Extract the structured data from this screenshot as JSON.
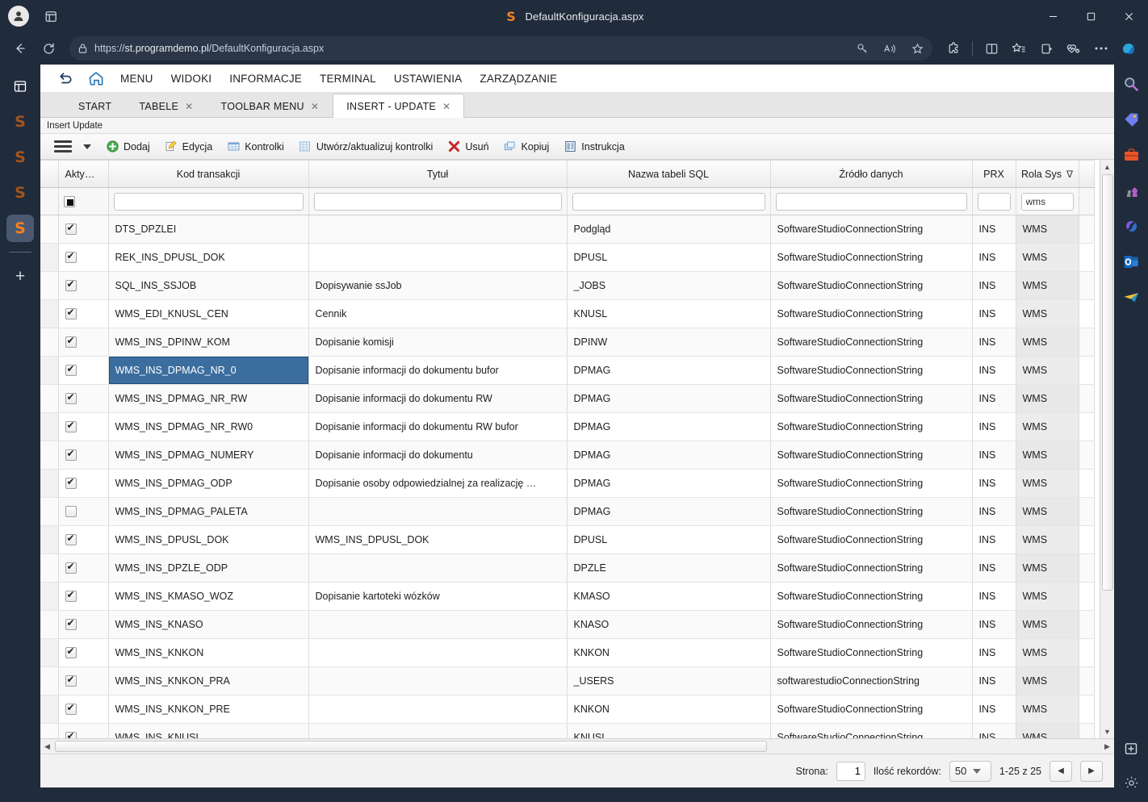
{
  "window": {
    "title": "DefaultKonfiguracja.aspx",
    "favicon": "S",
    "minimize_label": "–",
    "maximize_label": "❑",
    "close_label": "✕"
  },
  "browser": {
    "url_scheme": "https://",
    "url_host": "st.programdemo.pl",
    "url_path": "/DefaultKonfiguracja.aspx",
    "back_icon": "back-arrow-icon",
    "refresh_icon": "refresh-icon",
    "lock_icon": "lock-icon",
    "omnibox_icons": [
      "key-icon",
      "read-aloud-icon",
      "favorite-star-icon"
    ],
    "toolbar_icons": [
      "extensions-icon",
      "split-screen-icon",
      "favorites-icon",
      "collections-icon",
      "browser-essentials-icon",
      "settings-more-icon",
      "copilot-icon"
    ]
  },
  "left_sidebar": {
    "tabs_panel_icon": "vertical-tabs-icon",
    "items": [
      {
        "name": "tab-softwarestudio-1",
        "glyph": "S",
        "active": false
      },
      {
        "name": "tab-softwarestudio-2",
        "glyph": "S",
        "active": false
      },
      {
        "name": "tab-softwarestudio-3",
        "glyph": "S",
        "active": false
      },
      {
        "name": "tab-softwarestudio-4",
        "glyph": "S",
        "active": true
      }
    ],
    "add_tab_label": "+"
  },
  "right_sidebar": {
    "items": [
      {
        "name": "search-icon"
      },
      {
        "name": "tag-icon"
      },
      {
        "name": "briefcase-icon"
      },
      {
        "name": "games-icon"
      },
      {
        "name": "microsoft365-icon"
      },
      {
        "name": "outlook-icon"
      },
      {
        "name": "telegram-icon"
      }
    ],
    "add_label": "+",
    "settings_icon": "gear-icon"
  },
  "app": {
    "menu": {
      "back_icon": "undo-arrow-icon",
      "home_icon": "home-icon",
      "items": [
        "MENU",
        "WIDOKI",
        "INFORMACJE",
        "TERMINAL",
        "USTAWIENIA",
        "ZARZĄDZANIE"
      ]
    },
    "tabs": [
      {
        "label": "START",
        "closable": false,
        "active": false
      },
      {
        "label": "TABELE",
        "closable": true,
        "active": false
      },
      {
        "label": "TOOLBAR MENU",
        "closable": true,
        "active": false
      },
      {
        "label": "INSERT - UPDATE",
        "closable": true,
        "active": true
      }
    ],
    "tab_close_glyph": "✕",
    "breadcrumb": "Insert Update",
    "ribbon": {
      "menu_icon": "hamburger-menu-icon",
      "dropdown_icon": "chevron-down-icon",
      "buttons": [
        {
          "label": "Dodaj",
          "icon": "add-plus-icon"
        },
        {
          "label": "Edycja",
          "icon": "edit-pencil-icon"
        },
        {
          "label": "Kontrolki",
          "icon": "controls-grid-icon"
        },
        {
          "label": "Utwórz/aktualizuj kontrolki",
          "icon": "refresh-grid-icon"
        },
        {
          "label": "Usuń",
          "icon": "delete-x-icon"
        },
        {
          "label": "Kopiuj",
          "icon": "copy-icon"
        },
        {
          "label": "Instrukcja",
          "icon": "manual-document-icon"
        }
      ]
    }
  },
  "grid": {
    "columns": [
      {
        "key": "aktywne",
        "label": "Aktywne",
        "filtered": false
      },
      {
        "key": "kod",
        "label": "Kod transakcji",
        "filtered": false
      },
      {
        "key": "tytul",
        "label": "Tytuł",
        "filtered": false
      },
      {
        "key": "nazwa",
        "label": "Nazwa tabeli SQL",
        "filtered": false
      },
      {
        "key": "zrodlo",
        "label": "Źródło danych",
        "filtered": false
      },
      {
        "key": "prx",
        "label": "PRX",
        "filtered": false
      },
      {
        "key": "rola",
        "label": "Rola Sys",
        "filtered": true
      }
    ],
    "filter_funnel_glyph": "∇",
    "filters": {
      "aktywne": "",
      "kod": "",
      "tytul": "",
      "nazwa": "",
      "zrodlo": "",
      "prx": "",
      "rola": "wms"
    },
    "selected_cell": {
      "row": 5,
      "column": "kod"
    },
    "rows": [
      {
        "aktywne": true,
        "kod": "DTS_DPZLEI",
        "tytul": "",
        "nazwa": "Podgląd",
        "zrodlo": "SoftwareStudioConnectionString",
        "prx": "INS",
        "rola": "WMS"
      },
      {
        "aktywne": true,
        "kod": "REK_INS_DPUSL_DOK",
        "tytul": "",
        "nazwa": "DPUSL",
        "zrodlo": "SoftwareStudioConnectionString",
        "prx": "INS",
        "rola": "WMS"
      },
      {
        "aktywne": true,
        "kod": "SQL_INS_SSJOB",
        "tytul": "Dopisywanie ssJob",
        "nazwa": "_JOBS",
        "zrodlo": "SoftwareStudioConnectionString",
        "prx": "INS",
        "rola": "WMS"
      },
      {
        "aktywne": true,
        "kod": "WMS_EDI_KNUSL_CEN",
        "tytul": "Cennik",
        "nazwa": "KNUSL",
        "zrodlo": "SoftwareStudioConnectionString",
        "prx": "INS",
        "rola": "WMS"
      },
      {
        "aktywne": true,
        "kod": "WMS_INS_DPINW_KOM",
        "tytul": "Dopisanie komisji",
        "nazwa": "DPINW",
        "zrodlo": "SoftwareStudioConnectionString",
        "prx": "INS",
        "rola": "WMS"
      },
      {
        "aktywne": true,
        "kod": "WMS_INS_DPMAG_NR_0",
        "tytul": "Dopisanie informacji do dokumentu bufor",
        "nazwa": "DPMAG",
        "zrodlo": "SoftwareStudioConnectionString",
        "prx": "INS",
        "rola": "WMS"
      },
      {
        "aktywne": true,
        "kod": "WMS_INS_DPMAG_NR_RW",
        "tytul": "Dopisanie informacji do dokumentu RW",
        "nazwa": "DPMAG",
        "zrodlo": "SoftwareStudioConnectionString",
        "prx": "INS",
        "rola": "WMS"
      },
      {
        "aktywne": true,
        "kod": "WMS_INS_DPMAG_NR_RW0",
        "tytul": "Dopisanie informacji do dokumentu RW bufor",
        "nazwa": "DPMAG",
        "zrodlo": "SoftwareStudioConnectionString",
        "prx": "INS",
        "rola": "WMS"
      },
      {
        "aktywne": true,
        "kod": "WMS_INS_DPMAG_NUMERY",
        "tytul": "Dopisanie informacji do dokumentu",
        "nazwa": "DPMAG",
        "zrodlo": "SoftwareStudioConnectionString",
        "prx": "INS",
        "rola": "WMS"
      },
      {
        "aktywne": true,
        "kod": "WMS_INS_DPMAG_ODP",
        "tytul": "Dopisanie osoby odpowiedzialnej za realizację …",
        "nazwa": "DPMAG",
        "zrodlo": "SoftwareStudioConnectionString",
        "prx": "INS",
        "rola": "WMS"
      },
      {
        "aktywne": false,
        "kod": "WMS_INS_DPMAG_PALETA",
        "tytul": "",
        "nazwa": "DPMAG",
        "zrodlo": "SoftwareStudioConnectionString",
        "prx": "INS",
        "rola": "WMS"
      },
      {
        "aktywne": true,
        "kod": "WMS_INS_DPUSL_DOK",
        "tytul": "WMS_INS_DPUSL_DOK",
        "nazwa": "DPUSL",
        "zrodlo": "SoftwareStudioConnectionString",
        "prx": "INS",
        "rola": "WMS"
      },
      {
        "aktywne": true,
        "kod": "WMS_INS_DPZLE_ODP",
        "tytul": "",
        "nazwa": "DPZLE",
        "zrodlo": "SoftwareStudioConnectionString",
        "prx": "INS",
        "rola": "WMS"
      },
      {
        "aktywne": true,
        "kod": "WMS_INS_KMASO_WOZ",
        "tytul": "Dopisanie kartoteki wózków",
        "nazwa": "KMASO",
        "zrodlo": "SoftwareStudioConnectionString",
        "prx": "INS",
        "rola": "WMS"
      },
      {
        "aktywne": true,
        "kod": "WMS_INS_KNASO",
        "tytul": "",
        "nazwa": "KNASO",
        "zrodlo": "SoftwareStudioConnectionString",
        "prx": "INS",
        "rola": "WMS"
      },
      {
        "aktywne": true,
        "kod": "WMS_INS_KNKON",
        "tytul": "",
        "nazwa": "KNKON",
        "zrodlo": "SoftwareStudioConnectionString",
        "prx": "INS",
        "rola": "WMS"
      },
      {
        "aktywne": true,
        "kod": "WMS_INS_KNKON_PRA",
        "tytul": "",
        "nazwa": "_USERS",
        "zrodlo": "softwarestudioConnectionString",
        "prx": "INS",
        "rola": "WMS"
      },
      {
        "aktywne": true,
        "kod": "WMS_INS_KNKON_PRE",
        "tytul": "",
        "nazwa": "KNKON",
        "zrodlo": "SoftwareStudioConnectionString",
        "prx": "INS",
        "rola": "WMS"
      },
      {
        "aktywne": true,
        "kod": "WMS_INS_KNUSL",
        "tytul": "",
        "nazwa": "KNUSL",
        "zrodlo": "SoftwareStudioConnectionString",
        "prx": "INS",
        "rola": "WMS"
      }
    ]
  },
  "pager": {
    "page_label": "Strona:",
    "page_value": "1",
    "records_label": "Ilość rekordów:",
    "page_size": "50",
    "range_text": "1-25 z 25",
    "prev_glyph": "◀",
    "next_glyph": "▶"
  },
  "colors": {
    "chrome_bg": "#202b3c",
    "selection_blue": "#3b6e9e",
    "brand_orange": "#f5821f",
    "accent_home": "#2a7ab9"
  }
}
